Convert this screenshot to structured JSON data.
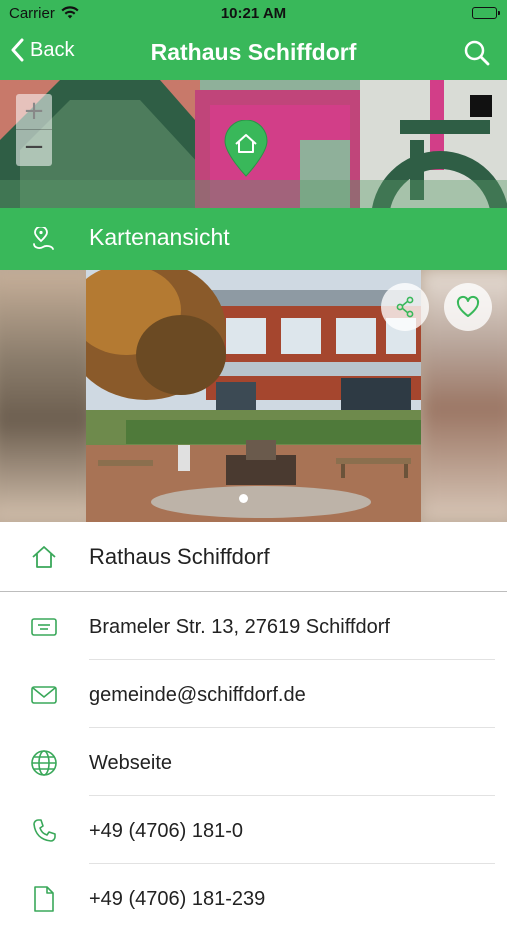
{
  "status_bar": {
    "carrier": "Carrier",
    "time": "10:21 AM"
  },
  "nav": {
    "back_label": "Back",
    "title": "Rathaus Schiffdorf",
    "search_icon": "search-icon"
  },
  "map": {
    "zoom_in": "+",
    "zoom_out": "−",
    "pin_icon": "home-pin-icon",
    "view_label": "Kartenansicht",
    "view_icon": "map-location-icon"
  },
  "gallery": {
    "share_icon": "share-icon",
    "favorite_icon": "heart-icon",
    "page_count": 1,
    "current_page": 1
  },
  "details": {
    "name": "Rathaus Schiffdorf",
    "address": "Brameler Str. 13, 27619 Schiffdorf",
    "email": "gemeinde@schiffdorf.de",
    "website": "Webseite",
    "phone": "+49 (4706) 181-0",
    "fax": "+49 (4706) 181-239"
  },
  "colors": {
    "accent": "#39b85a",
    "icon_green": "#3aa85a",
    "text": "#222222",
    "divider": "#e2e2e2"
  }
}
